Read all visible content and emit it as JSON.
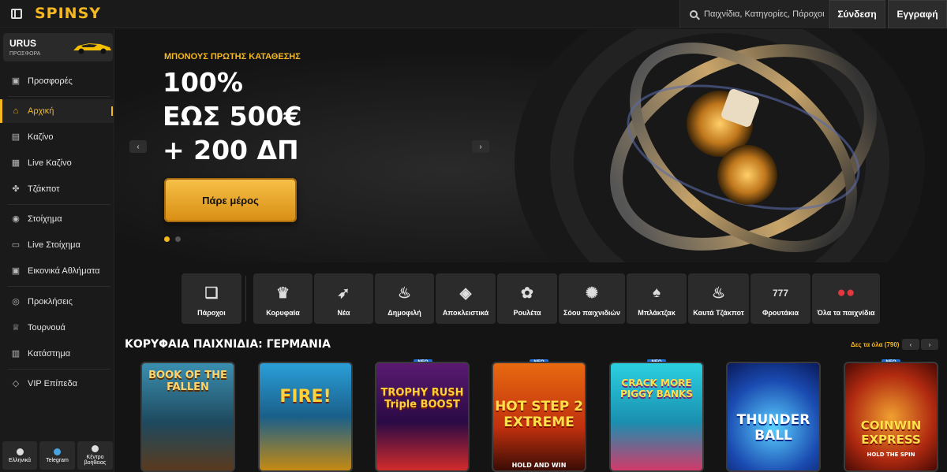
{
  "header": {
    "logo": "SPINSY",
    "search_placeholder": "Παιχνίδια, Κατηγορίες, Πάροχοι",
    "login": "Σύνδεση",
    "register": "Εγγραφή"
  },
  "sidebar": {
    "promo": {
      "title": "URUS",
      "subtitle": "ΠΡΟΣΦΟΡΑ"
    },
    "items": [
      {
        "label": "Προσφορές",
        "icon": "gift-icon"
      },
      {
        "label": "Αρχική",
        "icon": "home-icon"
      },
      {
        "label": "Καζίνο",
        "icon": "slot-icon"
      },
      {
        "label": "Live Καζίνο",
        "icon": "live-casino-icon"
      },
      {
        "label": "Τζάκποτ",
        "icon": "jackpot-icon"
      },
      {
        "label": "Στοίχημα",
        "icon": "betting-icon"
      },
      {
        "label": "Live Στοίχημα",
        "icon": "live-betting-icon"
      },
      {
        "label": "Εικονικά Αθλήματα",
        "icon": "virtual-sports-icon"
      },
      {
        "label": "Προκλήσεις",
        "icon": "challenges-icon"
      },
      {
        "label": "Τουρνουά",
        "icon": "trophy-icon"
      },
      {
        "label": "Κατάστημα",
        "icon": "shop-icon"
      },
      {
        "label": "VIP Επίπεδα",
        "icon": "diamond-icon"
      }
    ],
    "footer": [
      {
        "label": "Ελληνικά",
        "icon": "globe-icon"
      },
      {
        "label": "Telegram",
        "icon": "telegram-icon"
      },
      {
        "label": "Κέντρο βοήθειας",
        "icon": "help-icon"
      }
    ]
  },
  "hero": {
    "eyebrow": "ΜΠΟΝΟΥΣ ΠΡΩΤΗΣ ΚΑΤΑΘΕΣΗΣ",
    "line1": "100%",
    "line2": "ΕΩΣ 500€",
    "line3": "+ 200 ΔΠ",
    "cta": "Πάρε μέρος",
    "prev": "‹",
    "next": "›"
  },
  "categories": [
    {
      "label": "Πάροχοι",
      "icon": "book-icon",
      "glyph": "📖"
    },
    {
      "label": "Κορυφαία",
      "icon": "crown-icon",
      "glyph": "♛"
    },
    {
      "label": "Νέα",
      "icon": "rocket-icon",
      "glyph": "➶"
    },
    {
      "label": "Δημοφιλή",
      "icon": "flame-icon",
      "glyph": "♨"
    },
    {
      "label": "Αποκλειστικά",
      "icon": "gem-icon",
      "glyph": "◈"
    },
    {
      "label": "Ρουλέτα",
      "icon": "roulette-icon",
      "glyph": "✿"
    },
    {
      "label": "Σόου παιχνιδιών",
      "icon": "wheel-icon",
      "glyph": "✺"
    },
    {
      "label": "Μπλάκτζακ",
      "icon": "cards-icon",
      "glyph": "♠"
    },
    {
      "label": "Καυτά Τζάκποτ",
      "icon": "hot-pot-icon",
      "glyph": "♨"
    },
    {
      "label": "Φρουτάκια",
      "icon": "slots-777-icon",
      "glyph": "777"
    },
    {
      "label": "Όλα τα παιχνίδια",
      "icon": "cherries-icon",
      "glyph": "🍒"
    }
  ],
  "section": {
    "title": "ΚΟΡΥΦΑΙΑ ΠΑΙΧΝΙΔΙΑ: ΓΕΡΜΑΝΙΑ",
    "see_all": "Δες τα όλα (790)"
  },
  "new_badge": "ΝΕΟ",
  "games": [
    {
      "title": "BOOK OF THE FALLEN",
      "new": false
    },
    {
      "title": "FIRE!",
      "new": false
    },
    {
      "title": "TROPHY RUSH Triple BOOST",
      "new": true
    },
    {
      "title": "HOT STEP 2 EXTREME",
      "subtitle": "HOLD AND WIN",
      "new": true
    },
    {
      "title": "CRACK MORE PIGGY BANKS",
      "new": true
    },
    {
      "title": "THUNDER BALL",
      "new": false
    },
    {
      "title": "COINWIN EXPRESS",
      "subtitle": "HOLD THE SPIN",
      "new": true
    }
  ],
  "colors": {
    "accent": "#f5b820",
    "background": "#141414",
    "panel": "#1a1a1a"
  }
}
